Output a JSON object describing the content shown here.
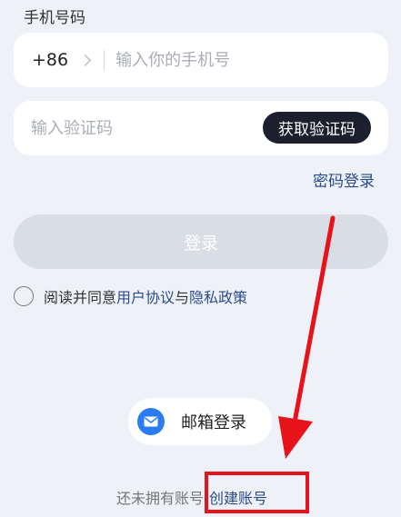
{
  "phone_section": {
    "label": "手机号码",
    "country_code": "+86",
    "phone_placeholder": "输入你的手机号"
  },
  "code_section": {
    "code_placeholder": "输入验证码",
    "get_code_label": "获取验证码"
  },
  "password_login_label": "密码登录",
  "login_button_label": "登录",
  "agreement": {
    "prefix": "阅读并同意",
    "user_agreement": "用户协议",
    "conjunction": "与",
    "privacy_policy": "隐私政策"
  },
  "email_login_label": "邮箱登录",
  "signup": {
    "prompt": "还未拥有账号",
    "link": "创建账号"
  },
  "colors": {
    "accent_link": "#2a4c8c",
    "annotation_red": "#e8121b",
    "mail_icon_blue": "#2a7cf4"
  },
  "icons": {
    "country_chevron": "chevron-right-icon",
    "email": "mail-icon"
  }
}
